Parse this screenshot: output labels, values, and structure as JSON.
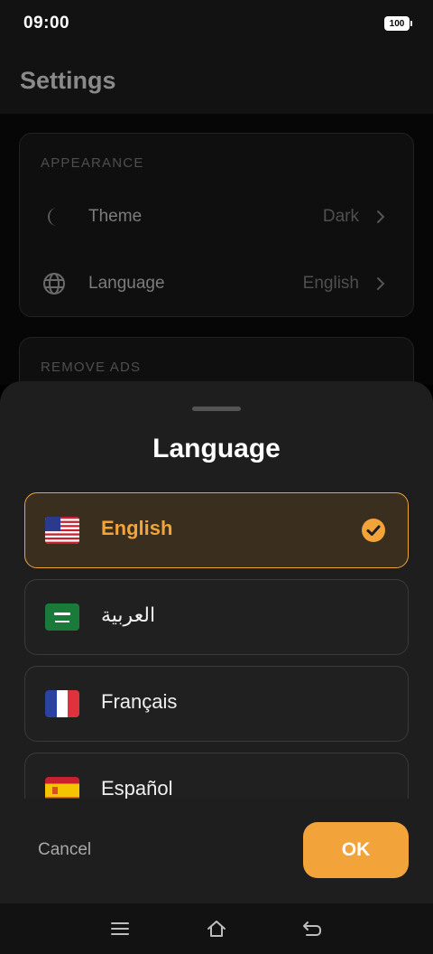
{
  "status_bar": {
    "time": "09:00",
    "battery": "100"
  },
  "header": {
    "title": "Settings"
  },
  "settings": {
    "appearance": {
      "label": "APPEARANCE",
      "rows": [
        {
          "label": "Theme",
          "value": "Dark",
          "icon": "moon-icon"
        },
        {
          "label": "Language",
          "value": "English",
          "icon": "globe-icon"
        }
      ]
    },
    "remove_ads": {
      "label": "REMOVE ADS"
    }
  },
  "sheet": {
    "title": "Language",
    "options": [
      {
        "label": "English",
        "flag": "us-flag-icon",
        "selected": true
      },
      {
        "label": "العربية",
        "flag": "saudi-flag-icon",
        "selected": false
      },
      {
        "label": "Français",
        "flag": "france-flag-icon",
        "selected": false
      },
      {
        "label": "Español",
        "flag": "spain-flag-icon",
        "selected": false
      }
    ],
    "cancel_label": "Cancel",
    "ok_label": "OK"
  },
  "colors": {
    "accent": "#f2a33a",
    "sheet_bg": "#1e1e1e",
    "selected_bg": "#3a2e1e"
  },
  "nav_bar": {
    "icons": [
      "menu-icon",
      "home-icon",
      "back-icon"
    ]
  }
}
